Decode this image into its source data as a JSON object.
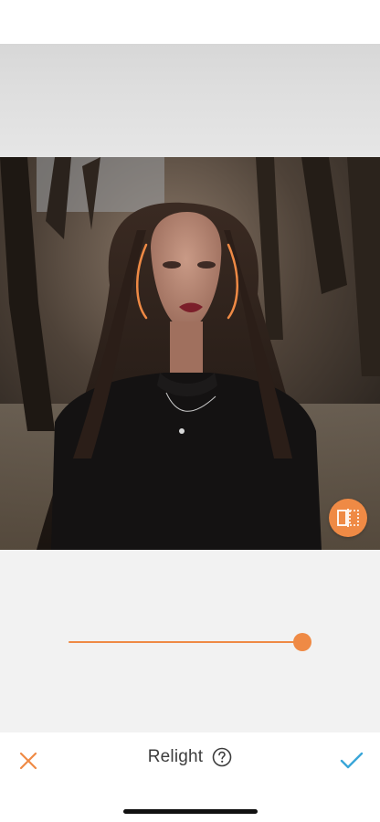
{
  "toolbar": {
    "title": "Relight",
    "cancel_icon": "close-icon",
    "help_icon": "help-icon",
    "apply_icon": "checkmark-icon"
  },
  "slider": {
    "value": 1.0
  },
  "colors": {
    "accent": "#ef8a45",
    "canvas_background": "#f2f2f2",
    "toolbar_background": "#ffffff",
    "text": "#3c3c3c",
    "apply_check": "#3aa6d8"
  },
  "compare_button": {
    "icon": "compare-icon"
  }
}
